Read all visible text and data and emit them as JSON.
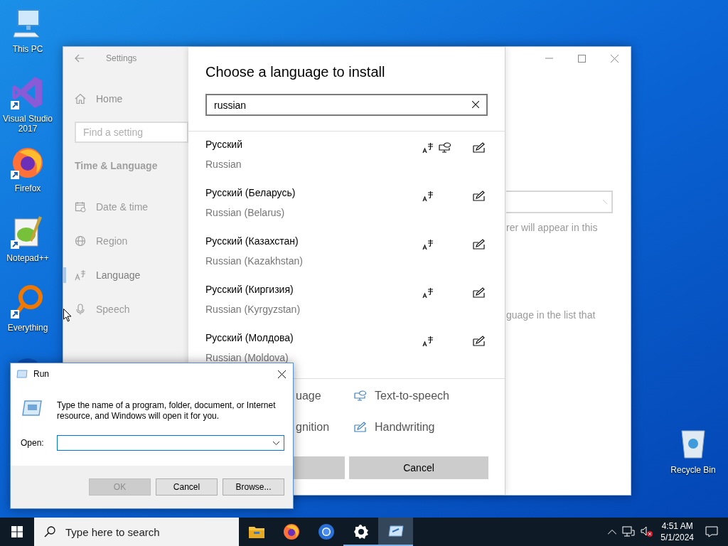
{
  "desktop": {
    "icons": [
      {
        "kind": "pc",
        "label": "This PC",
        "shortcut": false
      },
      {
        "kind": "vs",
        "label": "Visual Studio 2017",
        "shortcut": true
      },
      {
        "kind": "firefox",
        "label": "Firefox",
        "shortcut": true
      },
      {
        "kind": "notepad",
        "label": "Notepad++",
        "shortcut": true
      },
      {
        "kind": "everything",
        "label": "Everything",
        "shortcut": true
      },
      {
        "kind": "disc"
      }
    ],
    "recycle_bin": {
      "label": "Recycle Bin"
    }
  },
  "settings_window": {
    "app_title": "Settings",
    "home": "Home",
    "search_placeholder": "Find a setting",
    "section": "Time & Language",
    "nav": [
      {
        "kind": "calendar",
        "label": "Date & time",
        "selected": false
      },
      {
        "kind": "globe",
        "label": "Region",
        "selected": false
      },
      {
        "kind": "language",
        "label": "Language",
        "selected": true
      },
      {
        "kind": "mic",
        "label": "Speech",
        "selected": false
      }
    ],
    "content_fragments": [
      "rer will appear in this",
      "guage in the list that"
    ]
  },
  "language_dialog": {
    "title": "Choose a language to install",
    "search": {
      "value": "russian"
    },
    "languages": [
      {
        "name": "Русский",
        "english": "Russian",
        "display": true,
        "tts": true,
        "handwriting": true
      },
      {
        "name": "Русский (Беларусь)",
        "english": "Russian (Belarus)",
        "display": true,
        "tts": false,
        "handwriting": true
      },
      {
        "name": "Русский (Казахстан)",
        "english": "Russian (Kazakhstan)",
        "display": true,
        "tts": false,
        "handwriting": true
      },
      {
        "name": "Русский (Киргизия)",
        "english": "Russian (Kyrgyzstan)",
        "display": true,
        "tts": false,
        "handwriting": true
      },
      {
        "name": "Русский (Молдова)",
        "english": "Russian (Moldova)",
        "display": true,
        "tts": false,
        "handwriting": true
      }
    ],
    "legend": [
      {
        "kind": "cut",
        "label": "uage"
      },
      {
        "kind": "tts",
        "label": "Text-to-speech"
      },
      {
        "kind": "cut",
        "label": "gnition"
      },
      {
        "kind": "handwriting",
        "label": "Handwriting"
      }
    ],
    "cancel": "Cancel"
  },
  "run_dialog": {
    "title": "Run",
    "description": "Type the name of a program, folder, document, or Internet resource, and Windows will open it for you.",
    "open_label": "Open:",
    "buttons": [
      {
        "label": "OK",
        "disabled": true
      },
      {
        "label": "Cancel",
        "disabled": false
      },
      {
        "label": "Browse...",
        "disabled": false
      }
    ]
  },
  "taskbar": {
    "search_placeholder": "Type here to search",
    "apps": [
      {
        "kind": "explorer",
        "running": false,
        "selected": false
      },
      {
        "kind": "firefox",
        "running": false,
        "selected": false
      },
      {
        "kind": "chrome",
        "running": false,
        "selected": false
      },
      {
        "kind": "settings",
        "running": true,
        "selected": false
      },
      {
        "kind": "run",
        "running": true,
        "selected": true
      }
    ],
    "time": "4:51 AM",
    "date": "5/1/2024"
  }
}
